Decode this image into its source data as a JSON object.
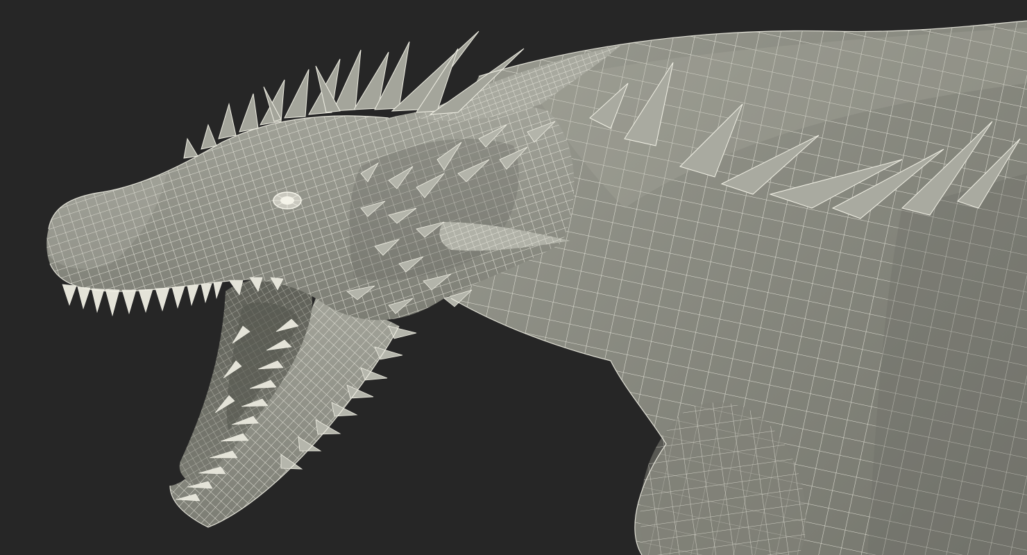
{
  "scene": {
    "background_color": "#262626",
    "mesh_fill_color": "#8f9086",
    "mesh_shade_color": "#6f7068",
    "wire_color": "#f2f1e6",
    "subject": "dragon-head-wireframe"
  }
}
